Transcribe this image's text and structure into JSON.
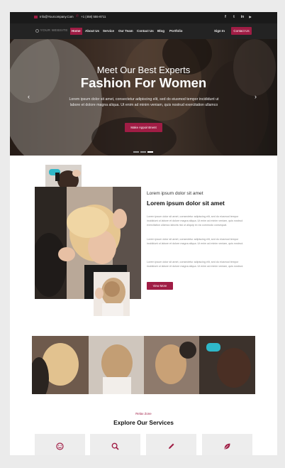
{
  "topbar": {
    "email": "Info@Yourcompany.Com",
    "phone": "+1 (458) 555-8711",
    "social": [
      {
        "name": "facebook",
        "glyph": "f"
      },
      {
        "name": "twitter",
        "glyph": "t"
      },
      {
        "name": "linkedin",
        "glyph": "in"
      },
      {
        "name": "youtube",
        "glyph": "▶"
      }
    ]
  },
  "nav": {
    "logo": "YOUR WEBSITE",
    "items": [
      "Home",
      "About Us",
      "Service",
      "Our Team",
      "Contact Us",
      "Blog",
      "Portfolio"
    ],
    "active": "Home",
    "signin": "Sign In",
    "contact": "Contact Us"
  },
  "hero": {
    "subtitle": "Meet Our Best Experts",
    "title": "Fashion For Women",
    "text": "Lorem ipsum dolor sit amet, consectetur adipiscing elit, sed do eiusmod tempor incididunt ut labore et dolore magna aliqua. Ut enim ad minim veniam, quis nostrud exercitation ullamco",
    "button": "Make Appointment",
    "prev_icon": "chevron-left-icon",
    "next_icon": "chevron-right-icon",
    "slides_total": 3,
    "slide_active": 2
  },
  "about": {
    "kicker": "Lorem ipsum dolor sit amet",
    "title": "Lorem ipsum dolor sit amet",
    "paragraphs": [
      "Lorem ipsum dolor sit amet, consectetur adipiscing elit, sed do eiusmod tempor incididunt ut labore et dolore magna aliqua. Ut enim ad minim veniam, quis nostrud exercitation ullamco laboris nisi ut aliquip ex ea commodo consequat.",
      "Lorem ipsum dolor sit amet, consectetur adipiscing elit, sed do eiusmod tempor incididunt ut labore et dolore magna aliqua. Ut enim ad minim veniam, quis nostrud.",
      "Lorem ipsum dolor sit amet, consectetur adipiscing elit, sed do eiusmod tempor incididunt ut labore et dolore magna aliqua. Ut enim ad minim veniam, quis nostrud."
    ],
    "button": "View More"
  },
  "services": {
    "kicker": "Relax Zone",
    "title": "Explore Our Services",
    "cards": [
      {
        "icon": "smile-icon"
      },
      {
        "icon": "search-icon"
      },
      {
        "icon": "pencil-icon"
      },
      {
        "icon": "leaf-icon"
      }
    ]
  },
  "colors": {
    "accent": "#a01d45",
    "topbar": "#1a1a1a",
    "navbar": "#232323",
    "background": "#ebebeb"
  }
}
